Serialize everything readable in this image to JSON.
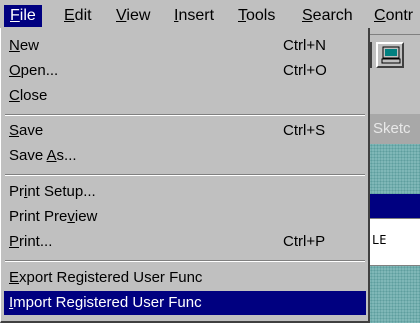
{
  "menubar": {
    "items": [
      {
        "pre": "",
        "mn": "F",
        "post": "ile"
      },
      {
        "pre": "",
        "mn": "E",
        "post": "dit"
      },
      {
        "pre": "",
        "mn": "V",
        "post": "iew"
      },
      {
        "pre": "",
        "mn": "I",
        "post": "nsert"
      },
      {
        "pre": "",
        "mn": "T",
        "post": "ools"
      },
      {
        "pre": "",
        "mn": "S",
        "post": "earch"
      },
      {
        "pre": "",
        "mn": "C",
        "post": "ontr"
      }
    ]
  },
  "file_menu": {
    "new": {
      "pre": "",
      "mn": "N",
      "post": "ew",
      "shortcut": "Ctrl+N"
    },
    "open": {
      "pre": "",
      "mn": "O",
      "post": "pen...",
      "shortcut": "Ctrl+O"
    },
    "close": {
      "pre": "",
      "mn": "C",
      "post": "lose"
    },
    "save": {
      "pre": "",
      "mn": "S",
      "post": "ave",
      "shortcut": "Ctrl+S"
    },
    "save_as": {
      "pre": "Save ",
      "mn": "A",
      "post": "s..."
    },
    "print_setup": {
      "pre": "Pr",
      "mn": "i",
      "post": "nt Setup..."
    },
    "print_preview": {
      "pre": "Print Pre",
      "mn": "v",
      "post": "iew"
    },
    "print": {
      "pre": "",
      "mn": "P",
      "post": "rint...",
      "shortcut": "Ctrl+P"
    },
    "export_user_func": {
      "pre": "",
      "mn": "E",
      "post": "xport Registered User Func"
    },
    "import_user_func": {
      "pre": "",
      "mn": "I",
      "post": "mport Registered User Func"
    }
  },
  "background": {
    "sketch_tab_label": "Sketc",
    "strip_text": "LE"
  },
  "colors": {
    "menu_bg": "#c0c0c0",
    "highlight": "#000080",
    "teal_pattern": "#7fb7b7"
  }
}
